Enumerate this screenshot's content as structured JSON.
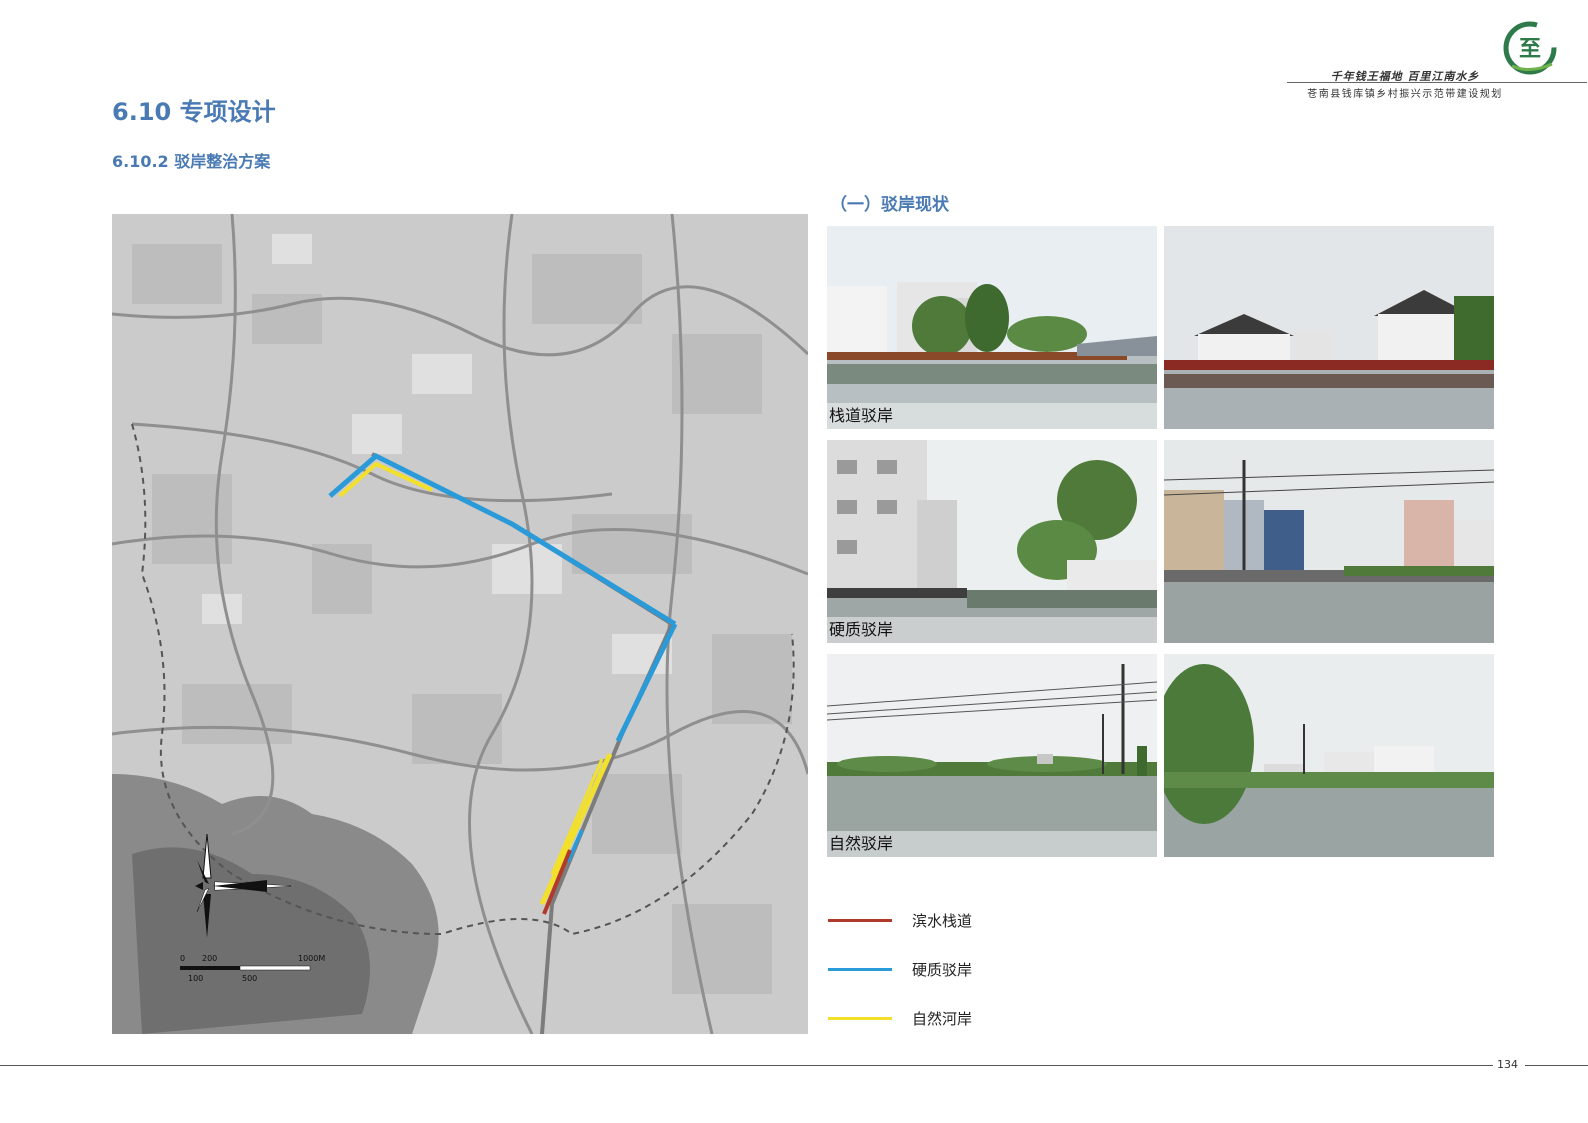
{
  "header": {
    "slogan": "千年钱王福地  百里江南水乡",
    "subtitle": "苍南县钱库镇乡村振兴示范带建设规划"
  },
  "section": {
    "title": "6.10  专项设计",
    "subtitle": "6.10.2 驳岸整治方案"
  },
  "map": {
    "scale_bar": {
      "labels_top": [
        "0",
        "200",
        "1000M"
      ],
      "labels_bottom": [
        "100",
        "500"
      ]
    },
    "routes": [
      {
        "type": "硬质驳岸",
        "color": "#2a9ad8"
      },
      {
        "type": "自然河岸",
        "color": "#f2e02a"
      },
      {
        "type": "滨水栈道",
        "color": "#b23a2a"
      }
    ]
  },
  "photos_section": {
    "heading": "（一）驳岸现状",
    "photos": [
      {
        "caption": "栈道驳岸"
      },
      {
        "caption": ""
      },
      {
        "caption": "硬质驳岸"
      },
      {
        "caption": ""
      },
      {
        "caption": "自然驳岸"
      },
      {
        "caption": ""
      }
    ]
  },
  "legend": [
    {
      "label": "滨水栈道",
      "color": "#b0392a"
    },
    {
      "label": "硬质驳岸",
      "color": "#2a9ad8"
    },
    {
      "label": "自然河岸",
      "color": "#f2e02a"
    }
  ],
  "footer": {
    "page_number": "134"
  }
}
